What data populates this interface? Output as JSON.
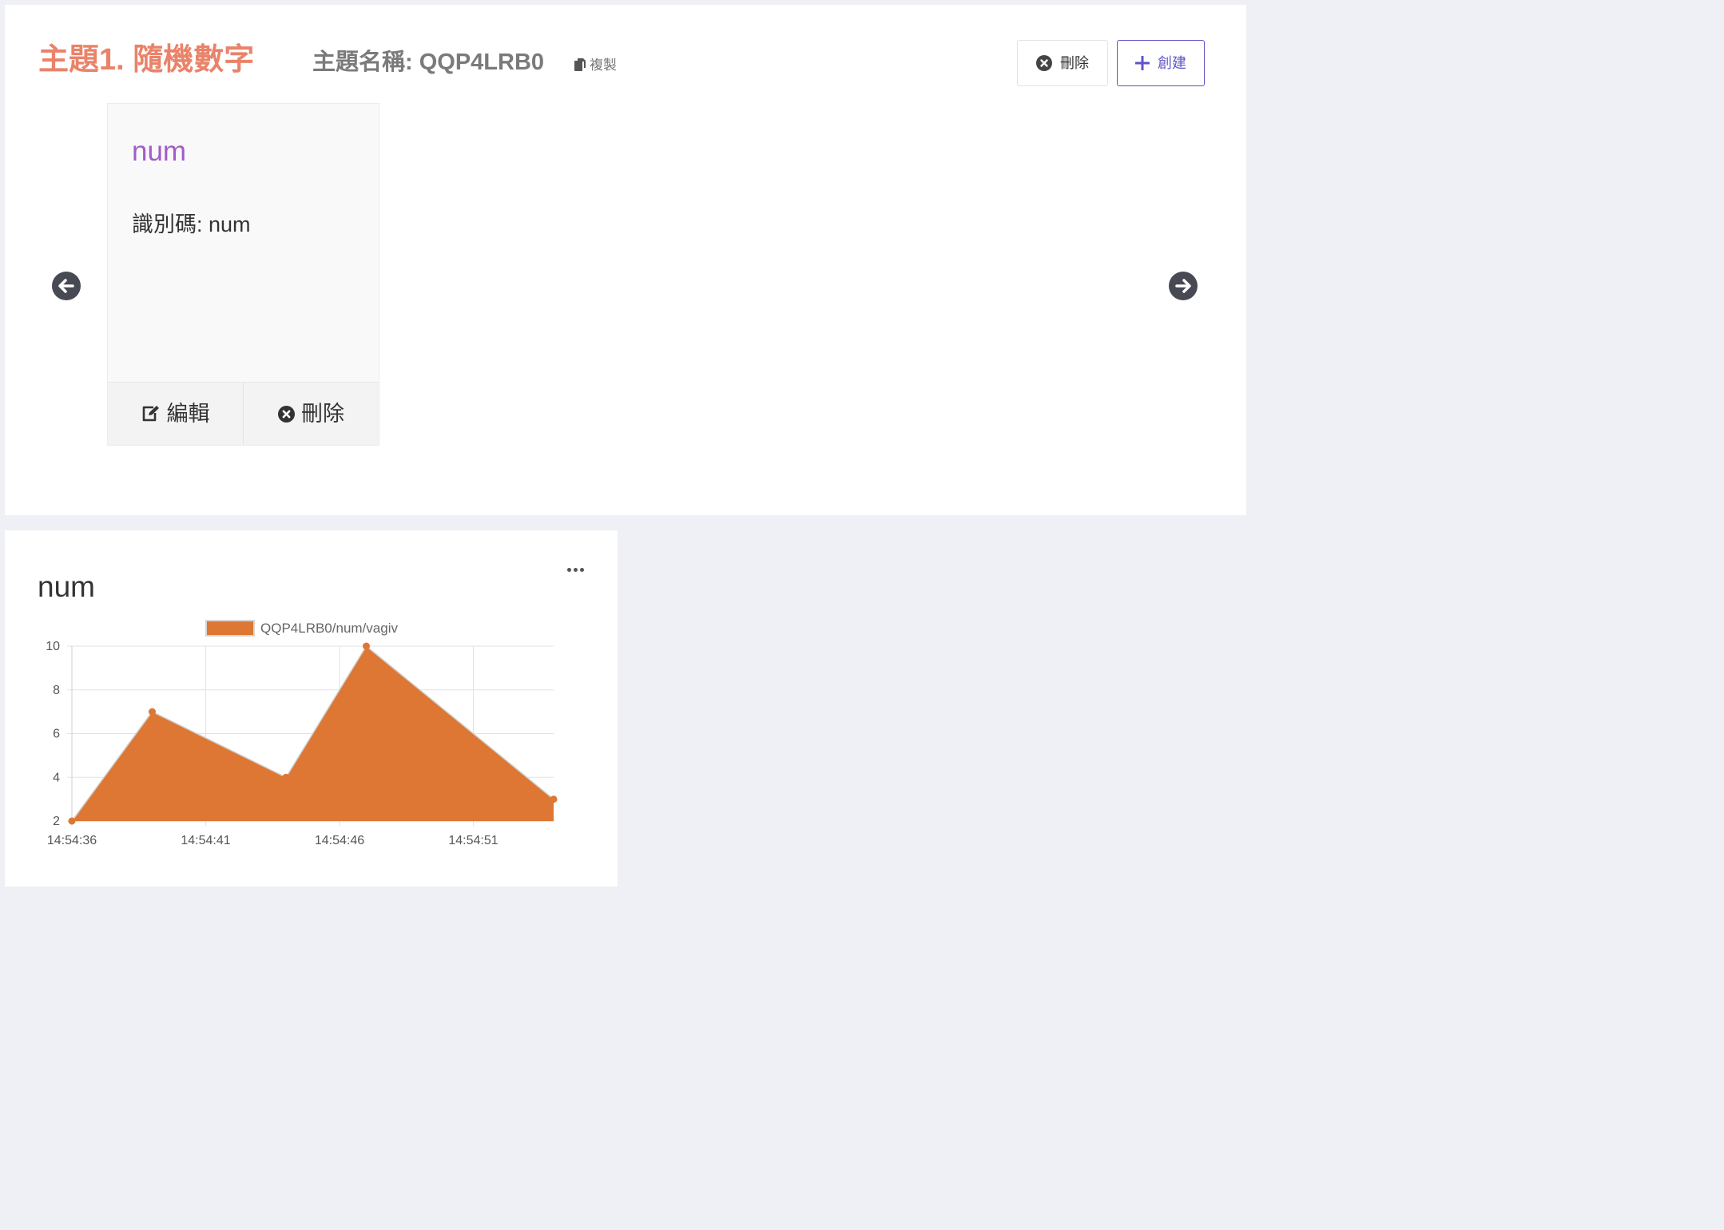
{
  "topic": {
    "title": "主題1. 隨機數字",
    "title_color": "#e9836a",
    "name_label": "主題名稱: QQP4LRB0",
    "copy_label": "複製",
    "delete_label": "刪除",
    "create_label": "創建",
    "create_color": "#5f54c6"
  },
  "card": {
    "title": "num",
    "title_color": "#a35bc9",
    "identifier": "識別碼: num",
    "edit_label": "編輯",
    "delete_label": "刪除"
  },
  "chart_panel": {
    "heading": "num"
  },
  "chart_data": {
    "type": "area",
    "series": [
      {
        "name": "QQP4LRB0/num/vagiv",
        "color": "#dd7733",
        "x": [
          0,
          3,
          8,
          11,
          18
        ],
        "values": [
          2,
          7,
          4,
          10,
          3
        ]
      }
    ],
    "x_ticks": [
      0,
      5,
      10,
      15
    ],
    "x_tick_labels": [
      "14:54:36",
      "14:54:41",
      "14:54:46",
      "14:54:51"
    ],
    "x_range": [
      0,
      18
    ],
    "y_ticks": [
      2,
      4,
      6,
      8,
      10
    ],
    "y_tick_labels": [
      "2",
      "4",
      "6",
      "8",
      "10"
    ],
    "ylim": [
      2,
      10
    ],
    "grid": true,
    "legend_position": "top-center"
  }
}
